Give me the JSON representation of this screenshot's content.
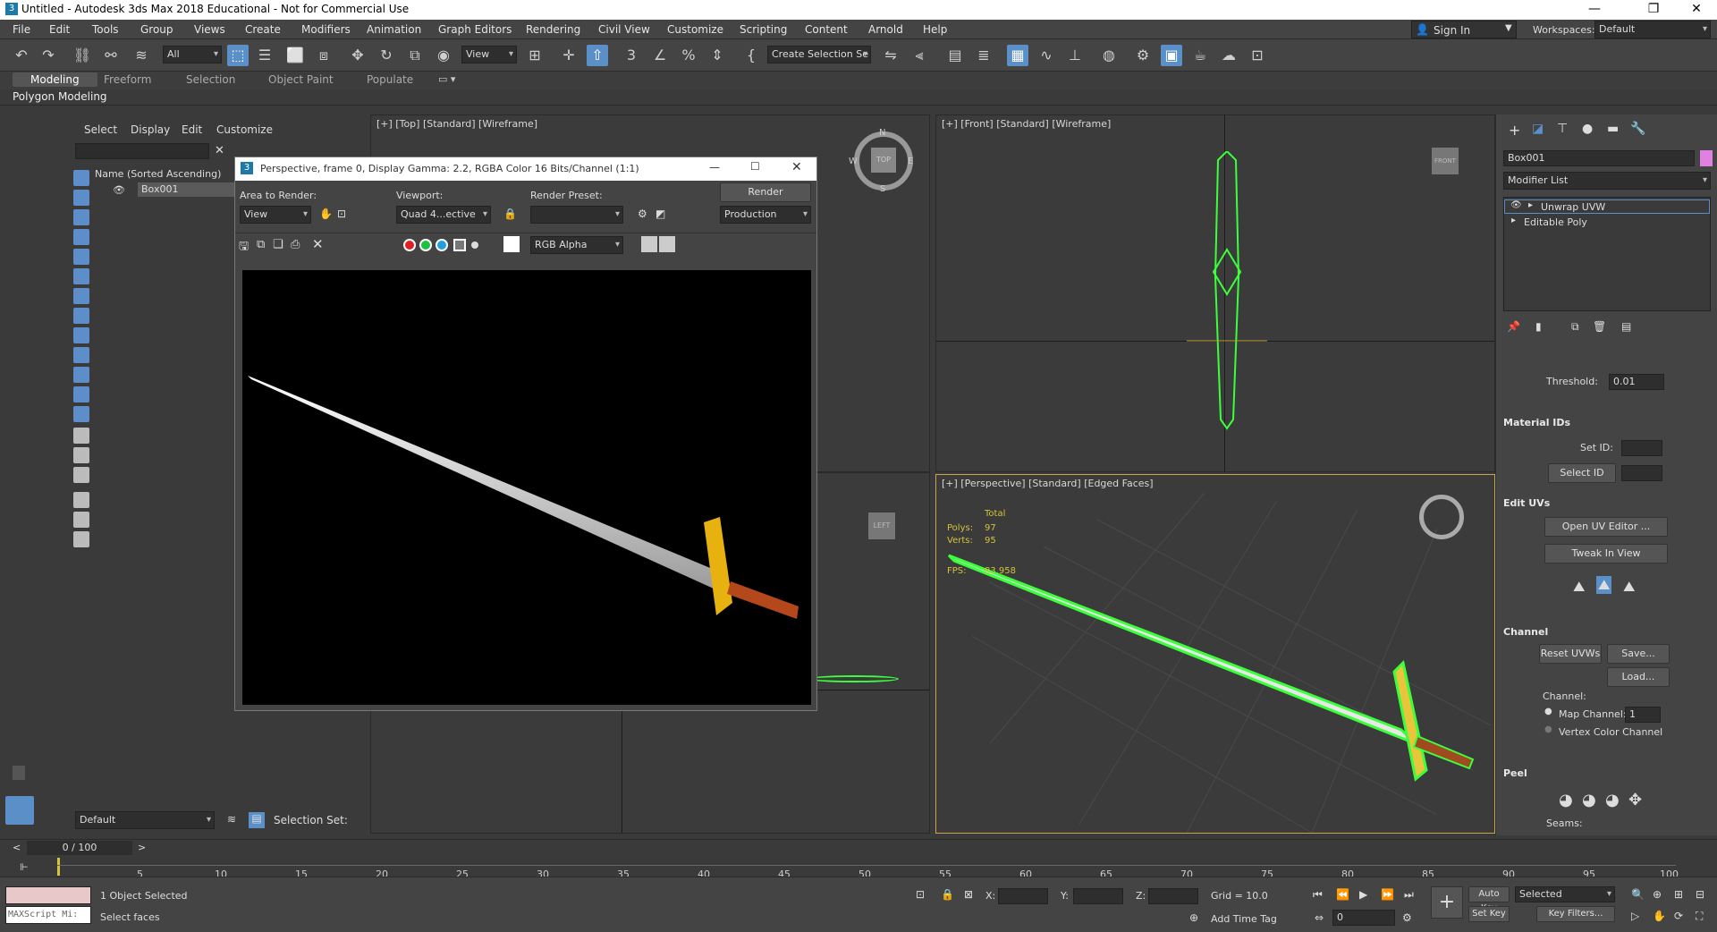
{
  "window": {
    "title": "Untitled - Autodesk 3ds Max 2018 Educational - Not for Commercial Use"
  },
  "menu": [
    "File",
    "Edit",
    "Tools",
    "Group",
    "Views",
    "Create",
    "Modifiers",
    "Animation",
    "Graph Editors",
    "Rendering",
    "Civil View",
    "Customize",
    "Scripting",
    "Content",
    "Arnold",
    "Help"
  ],
  "account": {
    "sign_in": "Sign In",
    "workspaces_label": "Workspaces:",
    "workspace": "Default"
  },
  "toolbar": {
    "filter": "All",
    "ref_coord": "View",
    "selection_set": "Create Selection Se"
  },
  "ribbon": {
    "tabs": [
      "Modeling",
      "Freeform",
      "Selection",
      "Object Paint",
      "Populate"
    ],
    "active_tab": "Modeling",
    "sub": "Polygon Modeling"
  },
  "scene_explorer": {
    "menus": [
      "Select",
      "Display",
      "Edit",
      "Customize"
    ],
    "column": "Name (Sorted Ascending)",
    "object": "Box001",
    "layer": "Default",
    "selection_set_label": "Selection Set:"
  },
  "viewports": {
    "top": "[+] [Top] [Standard] [Wireframe]",
    "front": "[+] [Front] [Standard] [Wireframe]",
    "persp": "[+] [Perspective] [Standard] [Edged Faces]",
    "left_cube": "LEFT",
    "front_cube": "FRONT",
    "top_cube": "TOP",
    "compass": {
      "n": "N",
      "s": "S",
      "e": "E",
      "w": "W"
    },
    "stats": {
      "total": "Total",
      "polys_label": "Polys:",
      "polys": "97",
      "verts_label": "Verts:",
      "verts": "95",
      "fps_label": "FPS:",
      "fps": "83.958"
    }
  },
  "render_window": {
    "title": "Perspective, frame 0, Display Gamma: 2.2, RGBA Color 16 Bits/Channel (1:1)",
    "area_label": "Area to Render:",
    "area": "View",
    "viewport_label": "Viewport:",
    "viewport": "Quad 4...ective",
    "preset_label": "Render Preset:",
    "preset": "",
    "render_button": "Render",
    "production": "Production",
    "channel": "RGB Alpha"
  },
  "command_panel": {
    "object_name": "Box001",
    "modifier_list": "Modifier List",
    "stack": [
      "Unwrap UVW",
      "Editable Poly"
    ],
    "threshold_label": "Threshold:",
    "threshold": "0.01",
    "material_ids": "Material IDs",
    "set_id": "Set ID:",
    "select_id": "Select ID",
    "edit_uvs": "Edit UVs",
    "open_uv_editor": "Open UV Editor ...",
    "tweak_in_view": "Tweak In View",
    "channel": "Channel",
    "reset_uvws": "Reset UVWs",
    "save": "Save...",
    "load": "Load...",
    "channel_label": "Channel:",
    "map_channel_label": "Map Channel:",
    "map_channel": "1",
    "vertex_color": "Vertex Color Channel",
    "peel": "Peel",
    "seams": "Seams:"
  },
  "timeline": {
    "frame": "0 / 100",
    "ticks": [
      "5",
      "10",
      "15",
      "20",
      "25",
      "30",
      "35",
      "40",
      "45",
      "50",
      "55",
      "60",
      "65",
      "70",
      "75",
      "80",
      "85",
      "90",
      "95",
      "100"
    ]
  },
  "status": {
    "selected": "1 Object Selected",
    "prompt": "Select faces",
    "maxscript": "MAXScript Mi:",
    "x": "X:",
    "y": "Y:",
    "z": "Z:",
    "grid": "Grid = 10.0",
    "add_time_tag": "Add Time Tag",
    "auto_key": "Auto Key",
    "set_key": "Set Key",
    "selected_dd": "Selected",
    "key_filters": "Key Filters...",
    "frame_spin": "0"
  },
  "colors": {
    "accent": "#5b8fc7",
    "selection_green": "#3cff3c",
    "bg": "#3a3a3a"
  }
}
